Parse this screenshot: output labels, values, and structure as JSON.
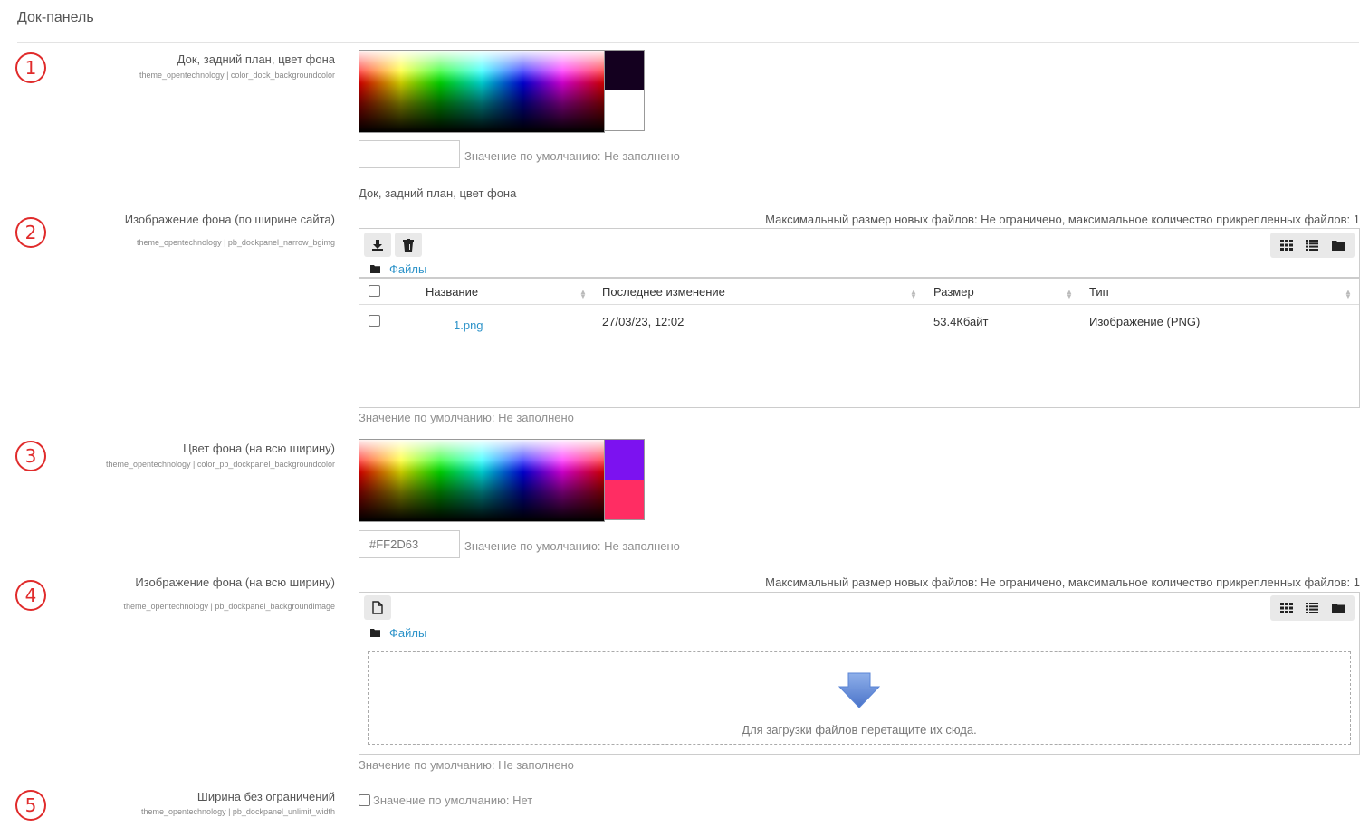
{
  "section": {
    "title": "Док-панель"
  },
  "markers": [
    "1",
    "2",
    "3",
    "4",
    "5"
  ],
  "setting1": {
    "label": "Док, задний план, цвет фона",
    "key": "theme_opentechnology | color_dock_backgroundcolor",
    "swatch_new": "#14001f",
    "swatch_current": "#ffffff",
    "value": "",
    "default_text": "Значение по умолчанию: Не заполнено",
    "description": "Док, задний план, цвет фона"
  },
  "setting2": {
    "label": "Изображение фона (по ширине сайта)",
    "key": "theme_opentechnology | pb_dockpanel_narrow_bgimg",
    "limits": "Максимальный размер новых файлов: Не ограничено, максимальное количество прикрепленных файлов: 1",
    "path_label": "Файлы",
    "columns": [
      "Название",
      "Последнее изменение",
      "Размер",
      "Тип"
    ],
    "rows": [
      {
        "name": "1.png",
        "modified": "27/03/23, 12:02",
        "size": "53.4Кбайт",
        "type": "Изображение (PNG)"
      }
    ],
    "default_text": "Значение по умолчанию: Не заполнено"
  },
  "setting3": {
    "label": "Цвет фона (на всю ширину)",
    "key": "theme_opentechnology | color_pb_dockpanel_backgroundcolor",
    "swatch_new": "#7c12f0",
    "swatch_current": "#ff2d63",
    "value": "#FF2D63",
    "default_text": "Значение по умолчанию: Не заполнено"
  },
  "setting4": {
    "label": "Изображение фона (на всю ширину)",
    "key": "theme_opentechnology | pb_dockpanel_backgroundimage",
    "limits": "Максимальный размер новых файлов: Не ограничено, максимальное количество прикрепленных файлов: 1",
    "path_label": "Файлы",
    "drop_text": "Для загрузки файлов перетащите их сюда.",
    "default_text": "Значение по умолчанию: Не заполнено"
  },
  "setting5": {
    "label": "Ширина без ограничений",
    "key": "theme_opentechnology | pb_dockpanel_unlimit_width",
    "checked": false,
    "default_text": "Значение по умолчанию: Нет"
  },
  "colors": {
    "marker": "#e02b2b",
    "link": "#2d93c9",
    "drop_arrow": "#5b85d6"
  },
  "icons": [
    "download-icon",
    "trash-icon",
    "file-icon",
    "folder-icon",
    "grid-view-icon",
    "list-view-icon",
    "tree-view-icon",
    "drop-arrow-icon"
  ]
}
